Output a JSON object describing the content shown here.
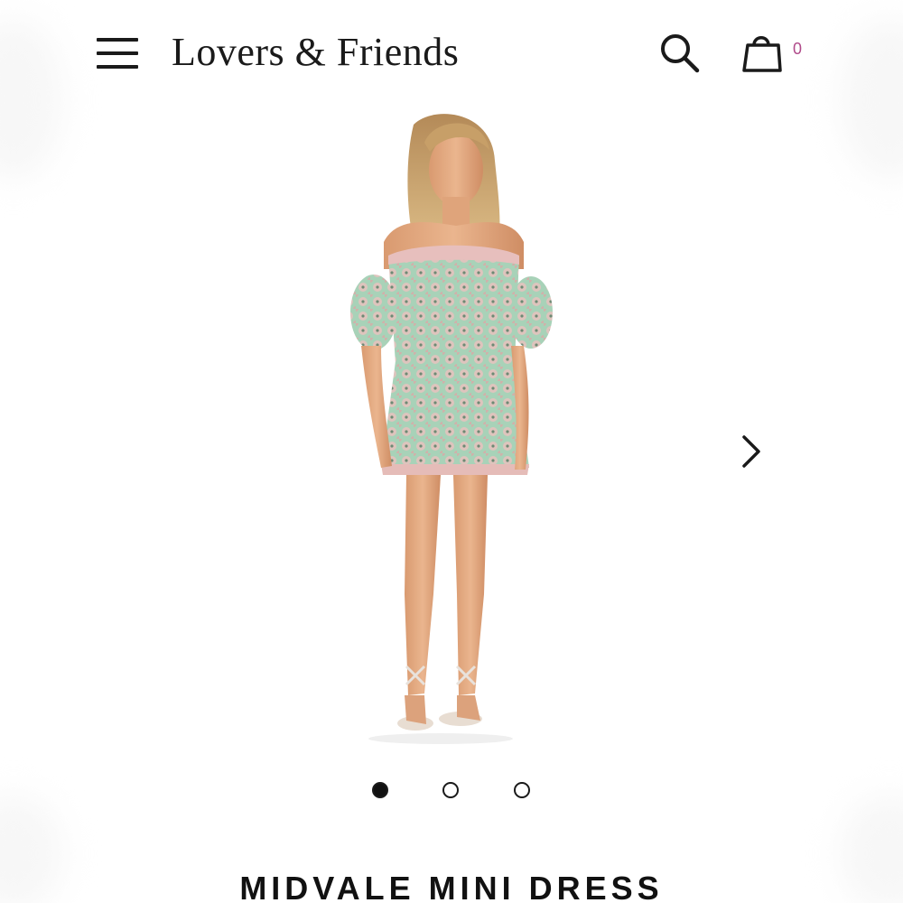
{
  "header": {
    "brand": "Lovers & Friends",
    "menu_icon": "hamburger-menu-icon",
    "search_icon": "search-icon",
    "cart_icon": "shopping-bag-icon",
    "cart_count": "0",
    "cart_count_color": "#b04a8a"
  },
  "gallery": {
    "image_alt": "model wearing off-shoulder floral lace mini dress",
    "next_icon": "chevron-right-icon",
    "slide_count": 3,
    "active_slide": 1
  },
  "product": {
    "title": "MIDVALE MINI DRESS"
  }
}
